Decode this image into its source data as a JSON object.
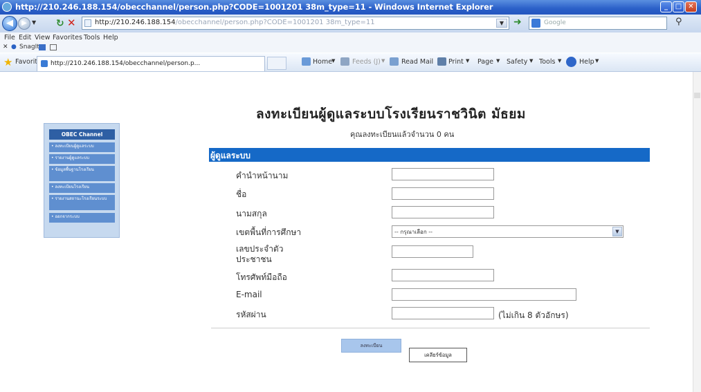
{
  "window": {
    "title": "http://210.246.188.154/obecchannel/person.php?CODE=1001201 38m_type=11 - Windows Internet Explorer",
    "controls": {
      "min": "_",
      "max": "□",
      "close": "✕"
    }
  },
  "addressbar": {
    "url_host": "http://210.246.188.154",
    "url_path": "/obecchannel/person.php?CODE=1001201 38m_type=11",
    "search_placeholder": "Google"
  },
  "menu": [
    "File",
    "Edit",
    "View",
    "Favorites",
    "Tools",
    "Help"
  ],
  "snagit": {
    "label": "SnagIt"
  },
  "favorites_bar": {
    "favorites": "Favorites",
    "tab_label": "http://210.246.188.154/obecchannel/person.p...",
    "home": "Home",
    "feeds": "Feeds (J)",
    "read_mail": "Read Mail",
    "print": "Print",
    "page": "Page",
    "safety": "Safety",
    "tools": "Tools",
    "help": "Help"
  },
  "sidebar": {
    "header": "OBEC Channel",
    "items": [
      "• ลงทะเบียนผู้ดูแลระบบ",
      "• รายงานผู้ดูแลระบบ",
      "• ข้อมูลพื้นฐานโรงเรียน",
      "• ลงทะเบียนโรงเรียน",
      "• รายงานสถานะโรงเรียนระบบ",
      "• ออกจากระบบ"
    ]
  },
  "main": {
    "title": "ลงทะเบียนผู้ดูแลระบบโรงเรียนราชวินิต มัธยม",
    "count_text": "คุณลงทะเบียนแล้วจำนวน 0 คน",
    "section_header": "ผู้ดูแลระบบ",
    "labels": {
      "prefix": "คำนำหน้านาม",
      "firstname": "ชื่อ",
      "lastname": "นามสกุล",
      "district": "เขตพื้นที่การศึกษา",
      "id_card_1": "เลขประจำตัว",
      "id_card_2": "ประชาชน",
      "mobile": "โทรศัพท์มือถือ",
      "email": "E-mail",
      "password": "รหัสผ่าน"
    },
    "district_value": "-- กรุณาเลือก --",
    "password_hint": "(ไม่เกิน 8 ตัวอักษร)",
    "submit": "ลงทะเบียน",
    "reset": "เคลียร์ข้อมูล"
  },
  "colors": {
    "section_header_bg": "#1569c7",
    "sidebar_bg": "#c6d9ef",
    "sidebar_item_bg": "#5f8fd0"
  }
}
